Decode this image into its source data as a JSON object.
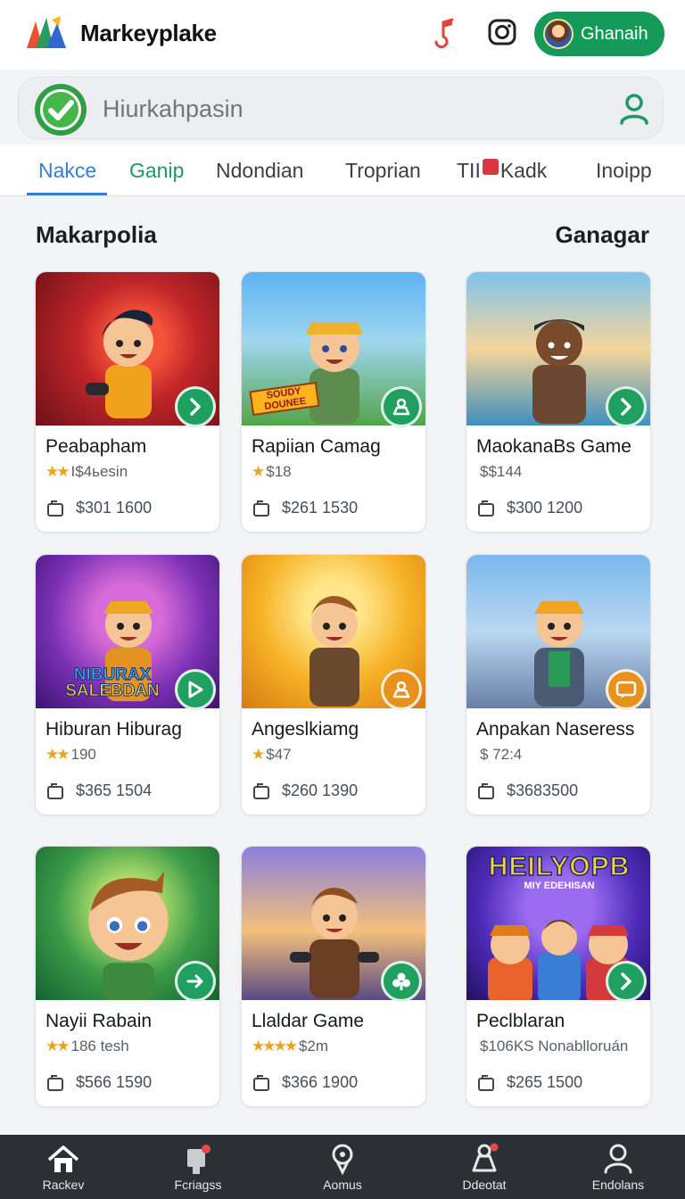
{
  "app": {
    "title": "Markeyplake",
    "profile_name": "Ghanaih"
  },
  "search": {
    "placeholder": "Hiurkahpasin"
  },
  "tabs": [
    {
      "label": "Nakce"
    },
    {
      "label": "Ganip"
    },
    {
      "label": "Ndondian"
    },
    {
      "label": "Troprian"
    },
    {
      "label_a": "TII",
      "label_b": "Kadk"
    },
    {
      "label": "Inoipp"
    }
  ],
  "section": {
    "title": "Makarpolia",
    "link": "Ganagar"
  },
  "games": [
    {
      "name": "Peabapham",
      "rating": "★★",
      "meta": "I$4ьesin",
      "price": "$301 1600",
      "action_icon": "arrow-right-icon"
    },
    {
      "name": "Rapiian Camag",
      "rating": "★",
      "meta": "$18",
      "price": "$261 1530",
      "action_icon": "person-icon"
    },
    {
      "name": "MaokanaBs Game",
      "rating": "",
      "meta": "$$144",
      "price": "$300 1200",
      "action_icon": "arrow-right-icon"
    },
    {
      "name": "Hiburan Hiburag",
      "rating": "★★",
      "meta": "190",
      "price": "$365 1504",
      "action_icon": "play-icon"
    },
    {
      "name": "Angeslkiamg",
      "rating": "★",
      "meta": "$47",
      "price": "$260 1390",
      "action_icon": "person-icon"
    },
    {
      "name": "Anpakan Naseress",
      "rating": "",
      "meta": "$ 72:4",
      "price": "$3683500",
      "action_icon": "chat-icon"
    },
    {
      "name": "Nayii Rabain",
      "rating": "★★",
      "meta": "186 tesh",
      "price": "$566 1590",
      "action_icon": "arrow-right-icon"
    },
    {
      "name": "Llaldar Game",
      "rating": "★★★★",
      "meta": "$2m",
      "price": "$366 1900",
      "action_icon": "club-icon"
    },
    {
      "name": "Peclblaran",
      "rating": "",
      "meta": "$106KS Nonablloruán",
      "price": "$265 1500",
      "action_icon": "arrow-right-icon"
    }
  ],
  "thumb_text": {
    "card2_sign": "SOUDY DOUNEE",
    "card4_banner_top": "NIBURAX",
    "card4_banner_bottom": "SALEBDAN",
    "card9_banner_top": "HEILYOPB",
    "card9_banner_bottom": "MIY EDEHISAN"
  },
  "bottom_nav": [
    {
      "label": "Rackev",
      "icon": "home-icon"
    },
    {
      "label": "Fcriagss",
      "icon": "store-icon"
    },
    {
      "label": "Aomus",
      "icon": "location-icon"
    },
    {
      "label": "Ddeotat",
      "icon": "support-icon"
    },
    {
      "label": "Endolans",
      "icon": "profile-icon"
    }
  ],
  "colors": {
    "accent_green": "#169a5a",
    "tab_active": "#3a7bd5",
    "star": "#e9a31c",
    "nav_bg": "#2c2f36"
  }
}
